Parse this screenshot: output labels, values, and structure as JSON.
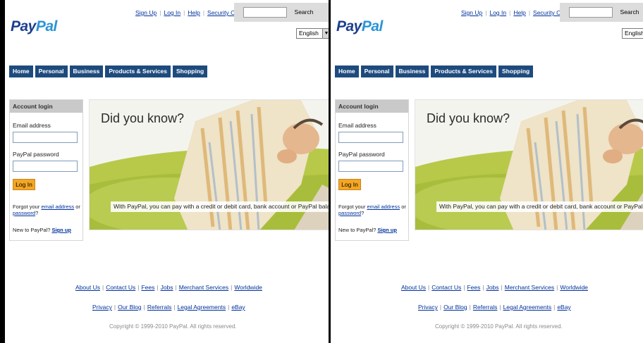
{
  "header": {
    "top_links": [
      "Sign Up",
      "Log In",
      "Help",
      "Security Center"
    ],
    "search_button": "Search",
    "search_value": "",
    "logo_pay": "Pay",
    "logo_pal": "Pal",
    "language": "English"
  },
  "nav": {
    "tabs": [
      "Home",
      "Personal",
      "Business",
      "Products & Services",
      "Shopping"
    ],
    "tab_color": "#1e4b7e"
  },
  "login": {
    "heading": "Account login",
    "email_label": "Email address",
    "password_label": "PayPal password",
    "button": "Log In",
    "button_color": "#f5a623",
    "forgot_prefix": "Forgot your ",
    "forgot_email_link": "email address",
    "forgot_or": " or ",
    "forgot_password_link": "password",
    "forgot_suffix": "?",
    "new_prefix": "New to PayPal? ",
    "signup_link": "Sign up"
  },
  "banner": {
    "title": "Did you know?",
    "caption": "With PayPal, you can pay with a credit or debit card, bank account or PayPal balance."
  },
  "footer": {
    "links_row1": [
      "About Us",
      "Contact Us",
      "Fees",
      "Jobs",
      "Merchant Services",
      "Worldwide"
    ],
    "links_row2": [
      "Privacy",
      "Our Blog",
      "Referrals",
      "Legal Agreements",
      "eBay"
    ],
    "copyright": "Copyright © 1999-2010 PayPal. All rights reserved."
  }
}
